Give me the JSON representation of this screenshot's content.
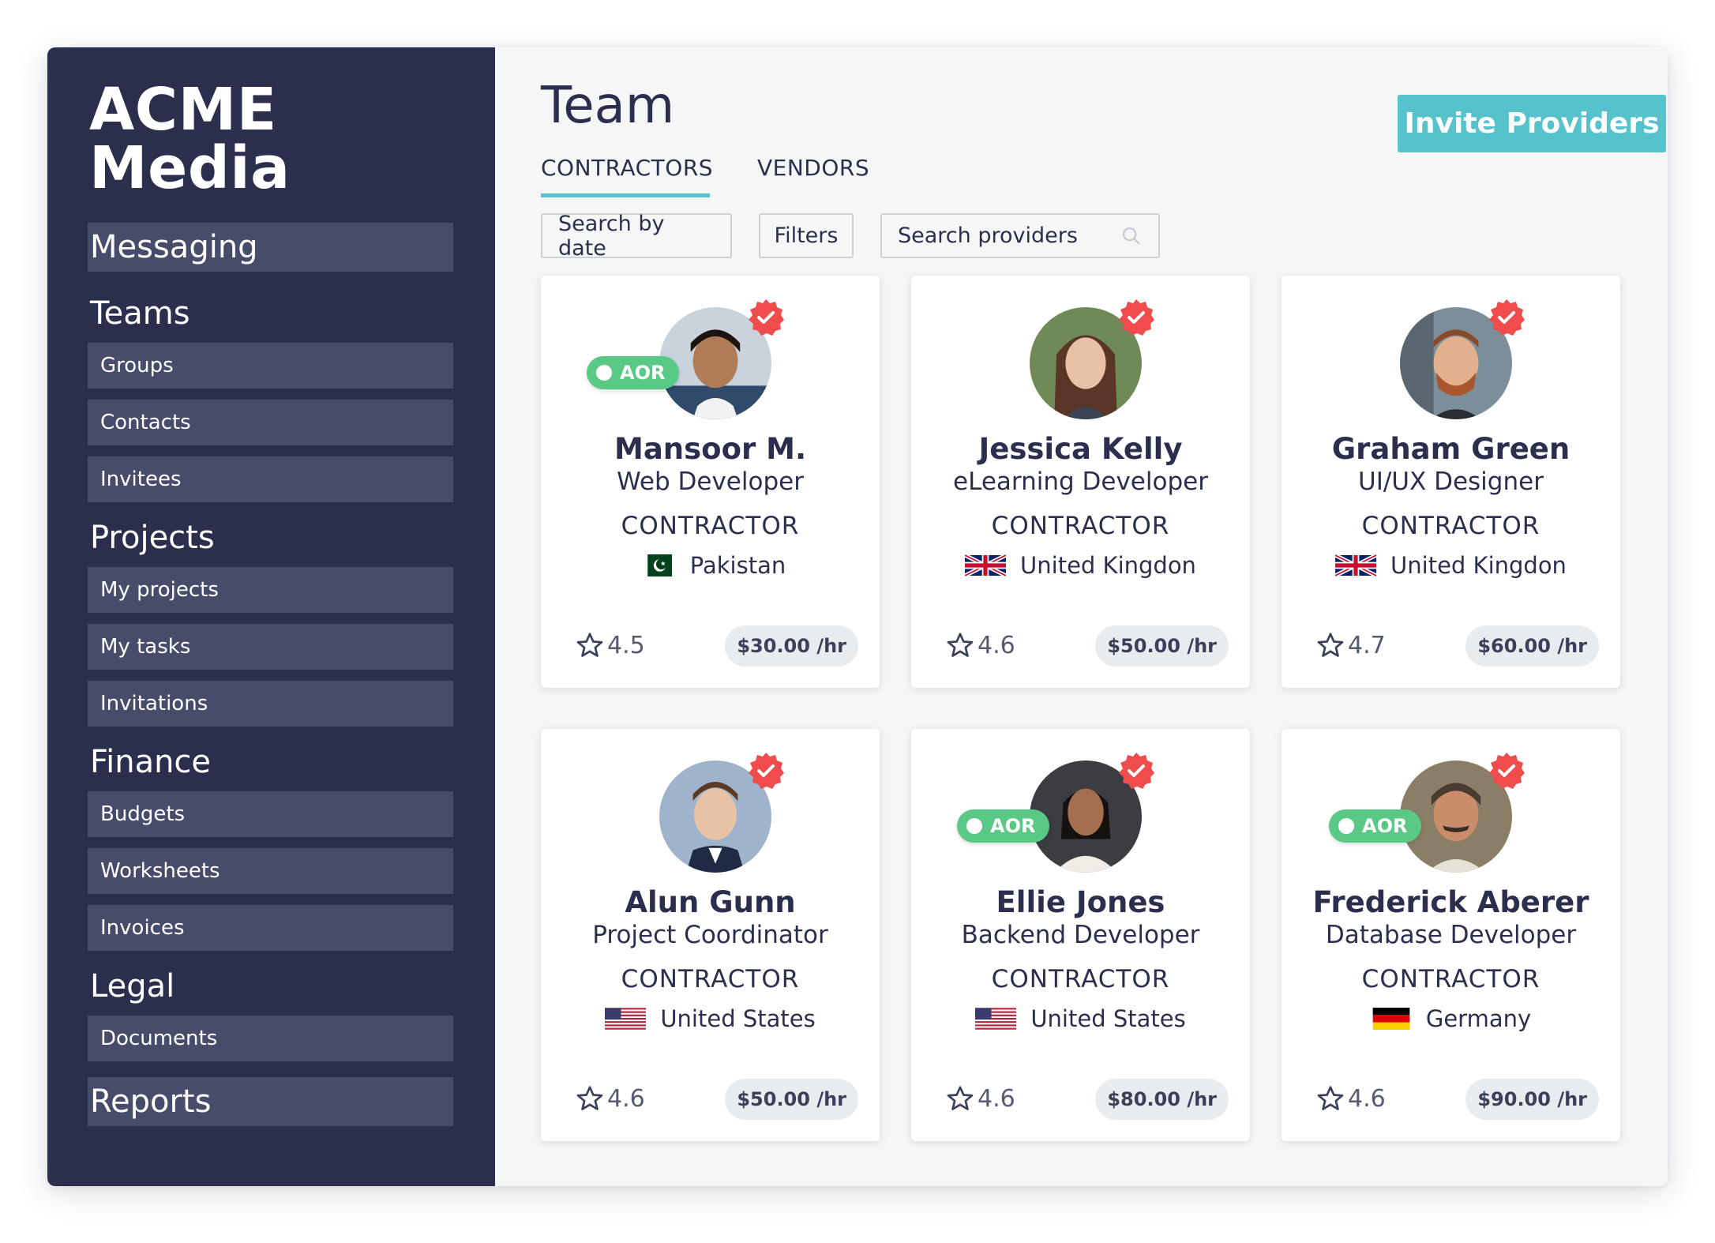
{
  "brand": "ACME Media",
  "sidebar": {
    "messaging": "Messaging",
    "teams": {
      "title": "Teams",
      "items": [
        "Groups",
        "Contacts",
        "Invitees"
      ]
    },
    "projects": {
      "title": "Projects",
      "items": [
        "My projects",
        "My tasks",
        "Invitations"
      ]
    },
    "finance": {
      "title": "Finance",
      "items": [
        "Budgets",
        "Worksheets",
        "Invoices"
      ]
    },
    "legal": {
      "title": "Legal",
      "items": [
        "Documents"
      ]
    },
    "reports": "Reports"
  },
  "header": {
    "title": "Team",
    "invite_label": "Invite Providers"
  },
  "tabs": [
    "CONTRACTORS",
    "VENDORS"
  ],
  "filters": {
    "date": "Search by date",
    "filters": "Filters",
    "search_placeholder": "Search providers"
  },
  "colors": {
    "sidebar": "#2b2f4d",
    "accent": "#56c2cb",
    "aor": "#5ac985",
    "verified": "#f04c4c"
  },
  "providers": [
    {
      "name": "Mansoor M.",
      "role": "Web Developer",
      "type": "CONTRACTOR",
      "country": "Pakistan",
      "flag": "pakistan-flag",
      "rating": "4.5",
      "rate": "$30.00 /hr",
      "aor": "AOR"
    },
    {
      "name": "Jessica Kelly",
      "role": "eLearning Developer",
      "type": "CONTRACTOR",
      "country": "United Kingdon",
      "flag": "uk-flag",
      "rating": "4.6",
      "rate": "$50.00 /hr"
    },
    {
      "name": "Graham Green",
      "role": "UI/UX Designer",
      "type": "CONTRACTOR",
      "country": "United Kingdon",
      "flag": "uk-flag",
      "rating": "4.7",
      "rate": "$60.00 /hr"
    },
    {
      "name": "Alun Gunn",
      "role": "Project Coordinator",
      "type": "CONTRACTOR",
      "country": "United States",
      "flag": "us-flag",
      "rating": "4.6",
      "rate": "$50.00 /hr"
    },
    {
      "name": "Ellie Jones",
      "role": "Backend Developer",
      "type": "CONTRACTOR",
      "country": "United States",
      "flag": "us-flag",
      "rating": "4.6",
      "rate": "$80.00 /hr",
      "aor": "AOR"
    },
    {
      "name": "Frederick Aberer",
      "role": "Database Developer",
      "type": "CONTRACTOR",
      "country": "Germany",
      "flag": "germany-flag",
      "rating": "4.6",
      "rate": "$90.00 /hr",
      "aor": "AOR"
    }
  ]
}
